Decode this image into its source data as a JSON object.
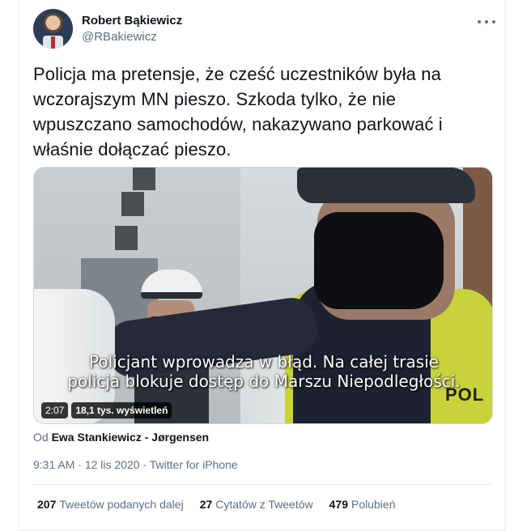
{
  "author": {
    "name": "Robert Bąkiewicz",
    "handle": "@RBakiewicz",
    "avatar_icon": "avatar-person"
  },
  "tweet": {
    "text_lines": [
      "Policja ma pretensje, że cześć uczestników była na",
      "wczorajszym MN pieszo. Szkoda tylko, że nie",
      "wpuszczano samochodów, nakazywano parkować i",
      "właśnie dołączać pieszo."
    ]
  },
  "video": {
    "subtitle_lines": [
      "Policjant wprowadza w błąd. Na całej trasie",
      "policja blokuje dostęp do Marszu Niepodległości."
    ],
    "scene_text": "POL",
    "duration": "2:07",
    "views": "18,1 tys. wyświetleń"
  },
  "attribution": {
    "prefix": "Od",
    "source": "Ewa Stankiewicz - Jørgensen"
  },
  "meta": {
    "time": "9:31 AM",
    "separator": "·",
    "date": "12 lis 2020",
    "client": "Twitter for iPhone"
  },
  "stats": [
    {
      "count": "207",
      "label": "Tweetów podanych dalej"
    },
    {
      "count": "27",
      "label": "Cytatów z Tweetów"
    },
    {
      "count": "479",
      "label": "Polubień"
    }
  ],
  "colors": {
    "text": "#0f1419",
    "secondary": "#5b7083",
    "border": "#e6ecf0"
  }
}
